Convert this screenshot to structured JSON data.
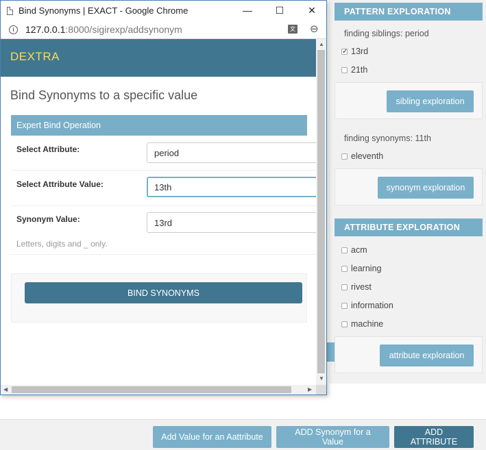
{
  "window": {
    "title": "Bind Synonyms | EXACT - Google Chrome",
    "url_host": "127.0.0.1",
    "url_rest": ":8000/sigirexp/addsynonym",
    "minimize": "—",
    "maximize": "☐",
    "close": "✕"
  },
  "app": {
    "brand": "DEXTRA",
    "page_title": "Bind Synonyms to a specific value",
    "module_header": "Expert Bind Operation",
    "form": {
      "attribute_label": "Select Attribute:",
      "attribute_value": "period",
      "attribute_value_label": "Select Attribute Value:",
      "attribute_value_value": "13th",
      "synonym_label": "Synonym Value:",
      "synonym_value": "13rd",
      "help_text": "Letters, digits and _ only."
    },
    "submit_label": "BIND SYNONYMS"
  },
  "background": {
    "pattern": {
      "header": "PATTERN EXPLORATION",
      "siblings_text": "finding siblings: period",
      "siblings": [
        {
          "label": "13rd",
          "checked": true
        },
        {
          "label": "21th",
          "checked": false
        }
      ],
      "sibling_button": "sibling exploration",
      "synonyms_text": "finding synonyms: 11th",
      "synonyms": [
        {
          "label": "eleventh",
          "checked": false
        }
      ],
      "synonym_button": "synonym exploration"
    },
    "attribute": {
      "header": "ATTRIBUTE EXPLORATION",
      "items": [
        {
          "label": "acm",
          "checked": false
        },
        {
          "label": "learning",
          "checked": false
        },
        {
          "label": "rivest",
          "checked": false
        },
        {
          "label": "information",
          "checked": false
        },
        {
          "label": "machine",
          "checked": false
        }
      ],
      "button": "attribute exploration"
    },
    "bottom": {
      "add_value": "Add Value for an Aattribute",
      "add_synonym": "ADD Synonym for a Value",
      "add_attribute": "ADD ATTRIBUTE"
    }
  },
  "colors": {
    "header_dark": "#417690",
    "header_light": "#79aec8",
    "brand_yellow": "#f5dd5d"
  }
}
